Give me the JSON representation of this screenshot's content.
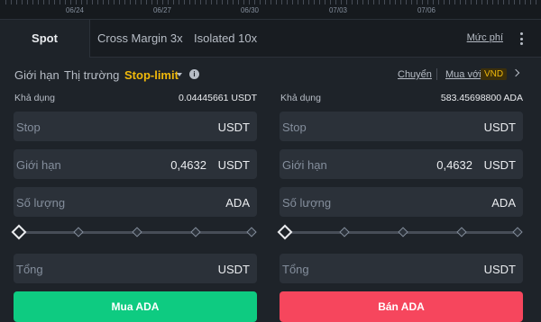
{
  "axis": {
    "dates": [
      "06/24",
      "06/27",
      "06/30",
      "07/03",
      "07/06"
    ]
  },
  "tabs": {
    "spot": "Spot",
    "cross_margin": "Cross Margin 3x",
    "isolated": "Isolated 10x",
    "fee_link": "Mức phí"
  },
  "order_types": {
    "limit": "Giới hạn",
    "market": "Thị trường",
    "stop_limit": "Stop-limit",
    "selected": "Stop-limit"
  },
  "top_actions": {
    "transfer": "Chuyển",
    "buy_with": "Mua với",
    "currency_badge": "VND"
  },
  "buy": {
    "avail_label": "Khả dụng",
    "avail_value": "0.04445661 USDT",
    "stop": {
      "label": "Stop",
      "value": "",
      "unit": "USDT"
    },
    "limit": {
      "label": "Giới hạn",
      "value": "0,4632",
      "unit": "USDT"
    },
    "amount": {
      "label": "Số lượng",
      "value": "",
      "unit": "ADA"
    },
    "slider_percent": 0,
    "total": {
      "label": "Tổng",
      "value": "",
      "unit": "USDT"
    },
    "button": "Mua ADA"
  },
  "sell": {
    "avail_label": "Khả dụng",
    "avail_value": "583.45698800 ADA",
    "stop": {
      "label": "Stop",
      "value": "",
      "unit": "USDT"
    },
    "limit": {
      "label": "Giới hạn",
      "value": "0,4632",
      "unit": "USDT"
    },
    "amount": {
      "label": "Số lượng",
      "value": "",
      "unit": "ADA"
    },
    "slider_percent": 0,
    "total": {
      "label": "Tổng",
      "value": "",
      "unit": "USDT"
    },
    "button": "Bán ADA"
  },
  "colors": {
    "accent": "#f0b90b",
    "buy": "#0ecb81",
    "sell": "#f6465d",
    "panel": "#1e2329",
    "input": "#2b3139"
  }
}
